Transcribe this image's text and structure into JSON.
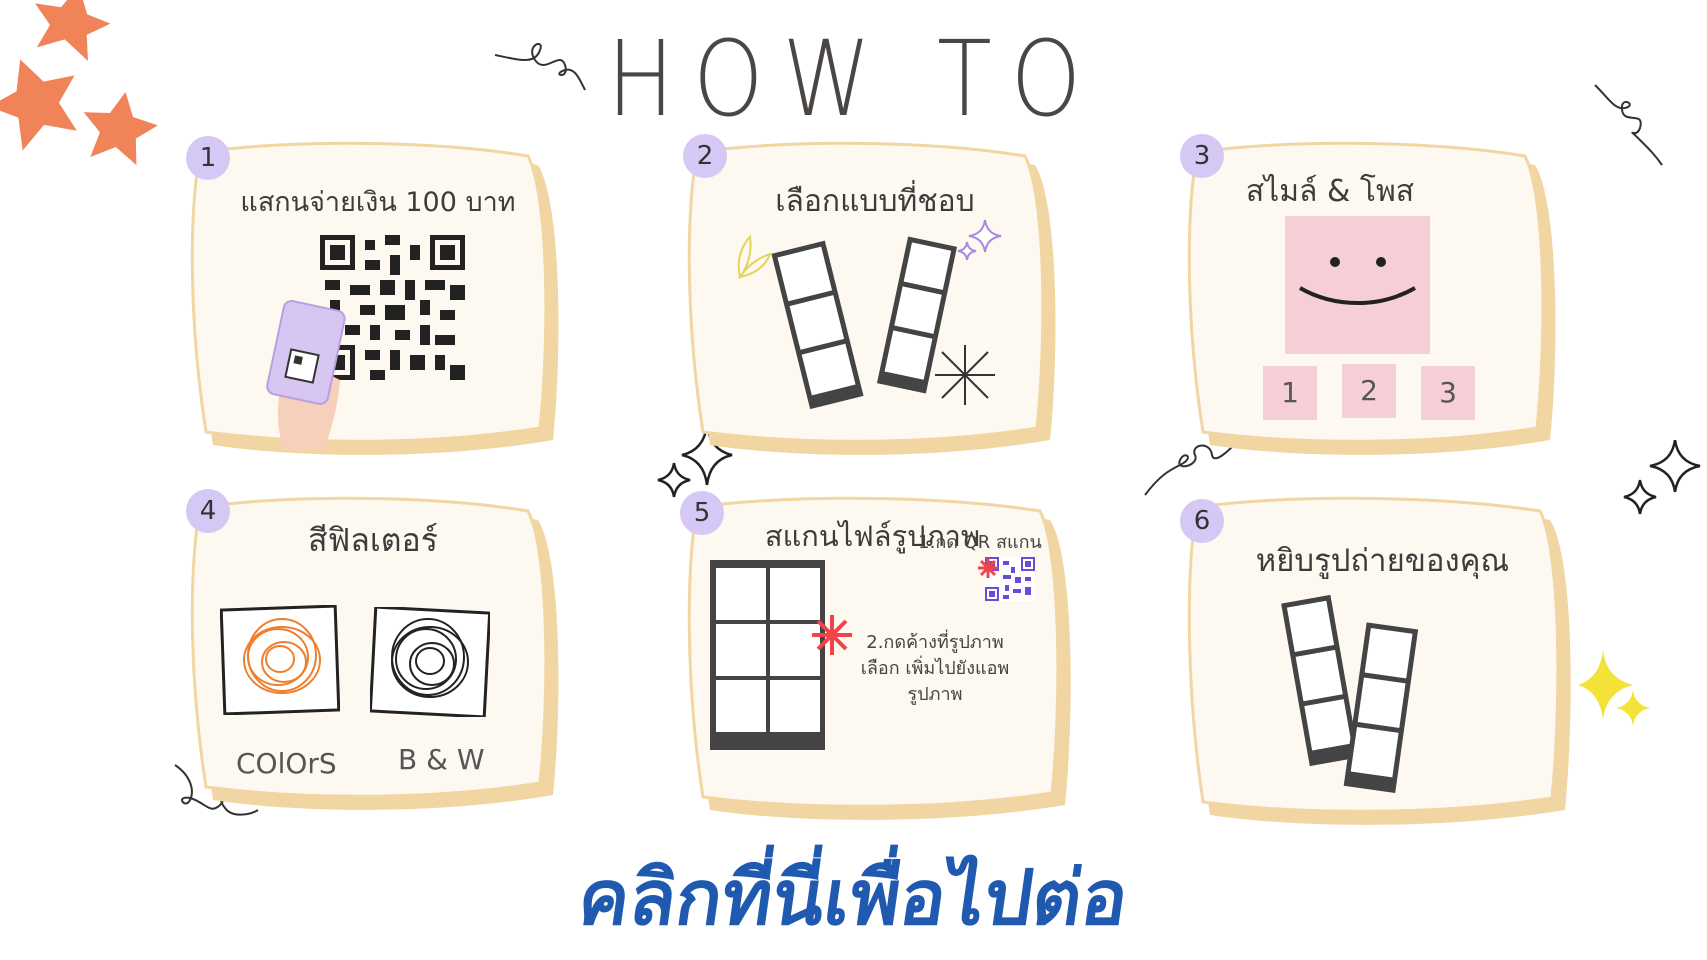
{
  "title": "HOW TO",
  "steps": [
    {
      "num": "1",
      "title": "แสกนจ่ายเงิน 100 บาท"
    },
    {
      "num": "2",
      "title": "เลือกแบบที่ชอบ"
    },
    {
      "num": "3",
      "title": "สไมล์ & โพส"
    },
    {
      "num": "4",
      "title": "สีฟิลเตอร์"
    },
    {
      "num": "5",
      "title": "สแกนไฟล์รูปภาพ"
    },
    {
      "num": "6",
      "title": "หยิบรูปถ่ายของคุณ"
    }
  ],
  "step3_poses": [
    "1",
    "2",
    "3"
  ],
  "step4_labels": {
    "colors": "COlOrS",
    "bw": "B & W"
  },
  "step5_notes": {
    "note1": "1.กด QR สแกน",
    "note2": "2.กดค้างที่รูปภาพ",
    "note3": "เลือก เพิ่มไปยังแอพ",
    "note4": "รูปภาพ"
  },
  "cta": "คลิกที่นี่เพื่อไปต่อ",
  "colors": {
    "card_fill": "#fdf9f1",
    "card_border": "#f1d6a3",
    "badge": "#d6c8f5",
    "cta": "#1f59b0",
    "star": "#f08358",
    "pink": "#f6cfd6"
  }
}
